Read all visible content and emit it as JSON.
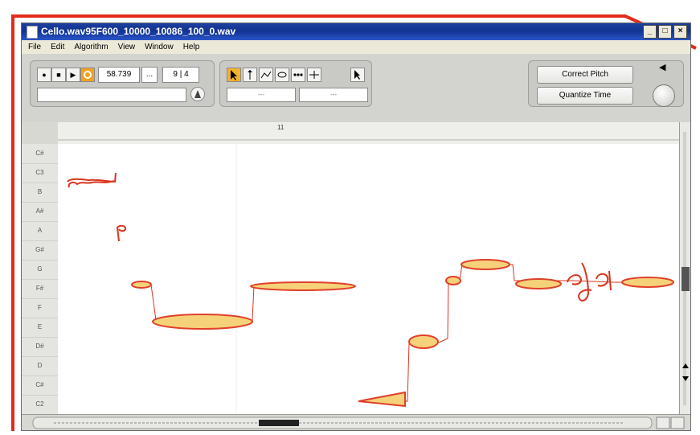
{
  "window": {
    "title": "Cello.wav95F600_10000_10086_100_0.wav",
    "controls": [
      "_",
      "□",
      "×"
    ]
  },
  "menu": [
    "File",
    "Edit",
    "Algorithm",
    "View",
    "Window",
    "Help"
  ],
  "transport": {
    "position": "58.739",
    "ellipsis": "...",
    "time_signature": "9 | 4",
    "record_symbol": "●",
    "stop_symbol": "■",
    "play_symbol": "▶"
  },
  "tool_fields": [
    "---",
    "---"
  ],
  "buttons": {
    "correct_pitch": "Correct Pitch",
    "quantize_time": "Quantize Time"
  },
  "ruler": {
    "bar_label": "11"
  },
  "piano_keys": [
    "C#",
    "C3",
    "B",
    "A#",
    "A",
    "G#",
    "G",
    "F#",
    "F",
    "E",
    "D#",
    "D",
    "C#",
    "C2"
  ],
  "colors": {
    "note_outline": "#e0402a",
    "note_fill": "#f5d27a",
    "annotation": "#d9341f",
    "title_blue": "#123390"
  }
}
